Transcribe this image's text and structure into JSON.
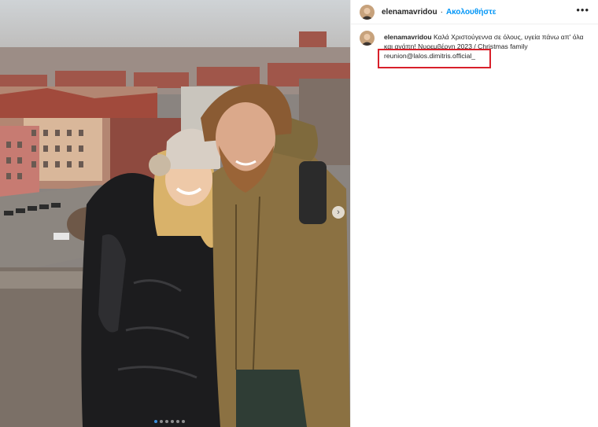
{
  "post": {
    "username": "elenamavridou",
    "separator": "·",
    "follow_label": "Ακολουθήστε",
    "more_icon": "more-horizontal-icon",
    "next_icon": "chevron-right-icon"
  },
  "caption": {
    "username": "elenamavridou",
    "text": "Καλά Χριστούγεννα σε όλους, υγεία πάνω απ' όλα και αγάπη! Νυρεμβέργη 2023 / Christmas family",
    "mention_line": "reunion@lalos.dimitris.official_"
  },
  "carousel": {
    "total_slides": 6,
    "active_slide": 1
  },
  "colors": {
    "follow": "#0095f6",
    "highlight_box": "#d8202a"
  }
}
